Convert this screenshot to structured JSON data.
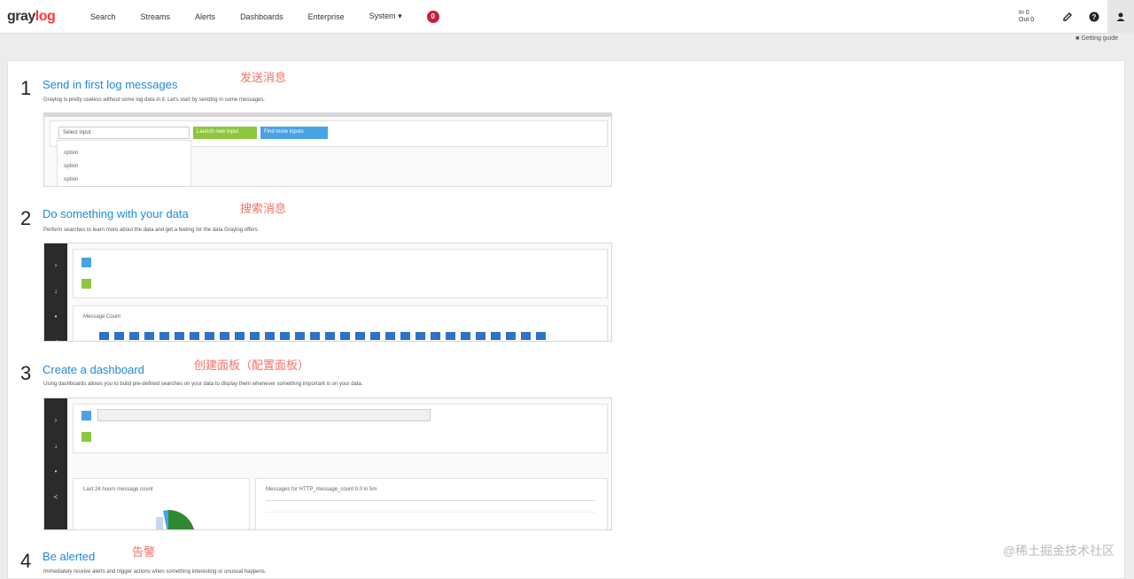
{
  "nav": {
    "logo_prefix": "gray",
    "logo_suffix": "log",
    "items": [
      "Search",
      "Streams",
      "Alerts",
      "Dashboards",
      "Enterprise",
      "System ▾"
    ],
    "notification_count": "0",
    "throughput": "In 0\nOut 0"
  },
  "subbar": {
    "link": "■ Getting guide"
  },
  "steps": [
    {
      "number": "1",
      "title": "Send in first log messages",
      "annotation": "发送消息",
      "desc": "Graylog is pretty useless without some log data in it. Let's start by sending in some messages."
    },
    {
      "number": "2",
      "title": "Do something with your data",
      "annotation": "搜索消息",
      "desc": "Perform searches to learn more about the data and get a feeling for the data Graylog offers"
    },
    {
      "number": "3",
      "title": "Create a dashboard",
      "annotation": "创建面板（配置面板）",
      "desc": "Using dashboards allows you to build pre-defined searches on your data to display them whenever something important is on your data."
    },
    {
      "number": "4",
      "title": "Be alerted",
      "annotation": "告警",
      "desc": "Immediately receive alerts and trigger actions when something interesting or unusual happens."
    }
  ],
  "shot1": {
    "select": "Select input",
    "btn_launch": "Launch new input",
    "btn_find": "Find more inputs",
    "options": [
      "option",
      "option",
      "option"
    ]
  },
  "shot2": {
    "chart_title": "Message Count"
  },
  "shot3": {
    "widget1": "Last 24 hours message count",
    "widget2": "Messages for HTTP_message_count 0.0 in 5m"
  },
  "watermark": "@稀土掘金技术社区"
}
